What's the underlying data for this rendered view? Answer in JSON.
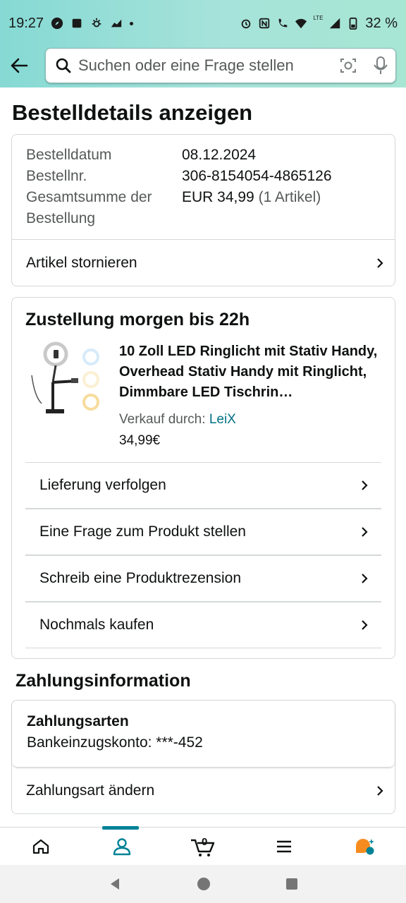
{
  "status_bar": {
    "time": "19:27",
    "battery": "32 %",
    "network_label": "LTE"
  },
  "search": {
    "placeholder": "Suchen oder eine Frage stellen"
  },
  "page": {
    "title": "Bestelldetails anzeigen"
  },
  "order_summary": {
    "date_label": "Bestelldatum",
    "date_value": "08.12.2024",
    "number_label": "Bestellnr.",
    "number_value": "306-8154054-4865126",
    "total_label": "Gesamtsumme der Bestellung",
    "total_value": "EUR 34,99",
    "total_items": "(1 Artikel)",
    "cancel_label": "Artikel stornieren"
  },
  "delivery": {
    "heading": "Zustellung morgen bis 22h",
    "product_title": "10 Zoll LED Ringlicht mit Stativ Handy, Overhead Stativ Handy mit Ringlicht, Dimmbare LED Tischrin…",
    "seller_prefix": "Verkauf durch:",
    "seller_name": "LeiX",
    "price": "34,99€",
    "actions": [
      {
        "label": "Lieferung verfolgen"
      },
      {
        "label": "Eine Frage zum Produkt stellen"
      },
      {
        "label": "Schreib eine Produktrezension"
      },
      {
        "label": "Nochmals kaufen"
      }
    ]
  },
  "payment": {
    "heading": "Zahlungsinformation",
    "methods_label": "Zahlungsarten",
    "method_value": "Bankeinzugskonto: ***-452",
    "change_label": "Zahlungsart ändern"
  },
  "bottom_nav": {
    "cart_count": "0",
    "active_tab": "account",
    "accent_color": "#008296"
  },
  "icons": [
    "back-arrow-icon",
    "search-icon",
    "camera-icon",
    "mic-icon",
    "chevron-right-icon",
    "home-icon",
    "account-icon",
    "cart-icon",
    "menu-icon",
    "rufus-icon"
  ]
}
